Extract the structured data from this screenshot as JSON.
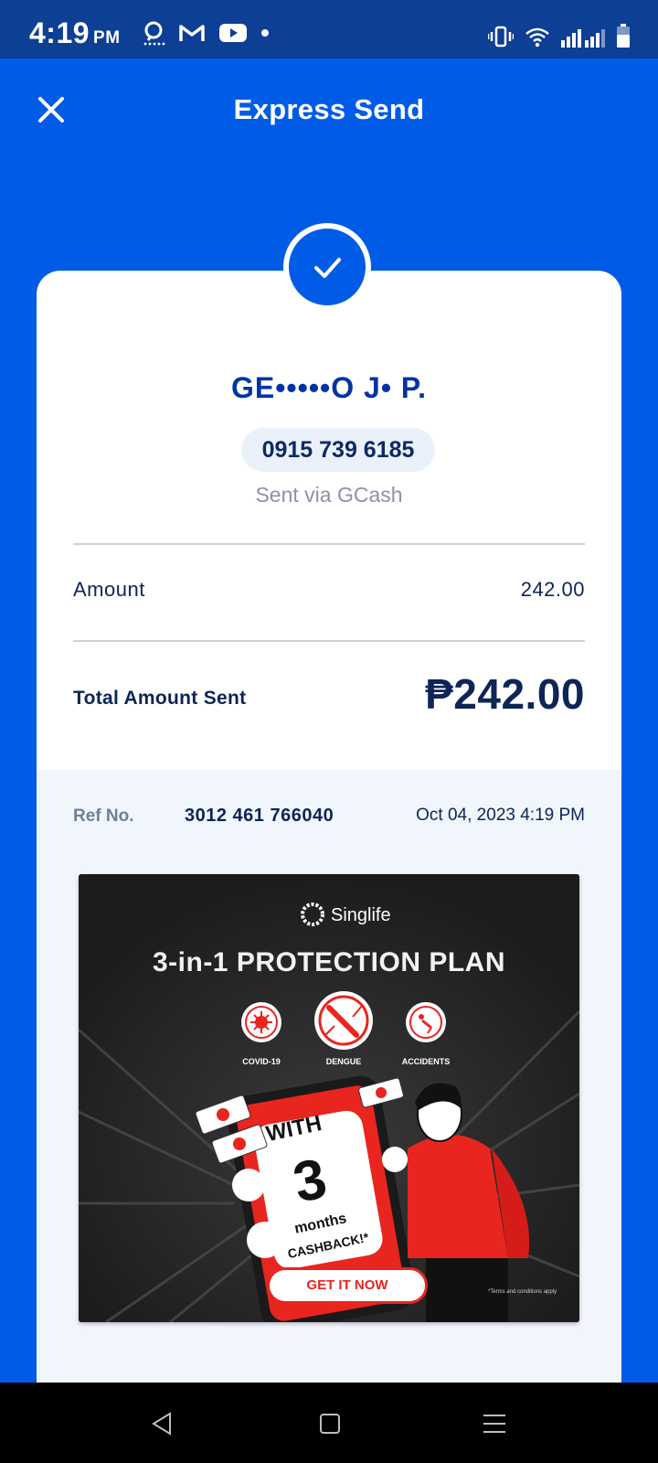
{
  "status_bar": {
    "time": "4:19",
    "ampm": "PM"
  },
  "header": {
    "title": "Express Send",
    "close_icon": "close-icon"
  },
  "colors": {
    "brand_blue": "#005ce6",
    "status_bar": "#0d3f94",
    "text_navy": "#0d2557",
    "banner_red": "#e8251f"
  },
  "receipt": {
    "recipient_name": "GE•••••O J• P.",
    "phone": "0915 739 6185",
    "sent_via": "Sent via GCash",
    "amount_label": "Amount",
    "amount_value": "242.00",
    "total_label": "Total Amount Sent",
    "total_value": "₱242.00",
    "ref_label": "Ref No.",
    "ref_number": "3012 461 766040",
    "date": "Oct 04, 2023 4:19 PM"
  },
  "banner": {
    "brand": "Singlife",
    "headline": "3-in-1 PROTECTION PLAN",
    "coverages": [
      "COVID-19",
      "DENGUE",
      "ACCIDENTS"
    ],
    "phone_text_1": "WITH",
    "phone_text_2": "3",
    "phone_text_3": "months",
    "phone_text_4": "CASHBACK!*",
    "cta": "GET IT NOW",
    "terms": "*Terms and conditions apply"
  }
}
